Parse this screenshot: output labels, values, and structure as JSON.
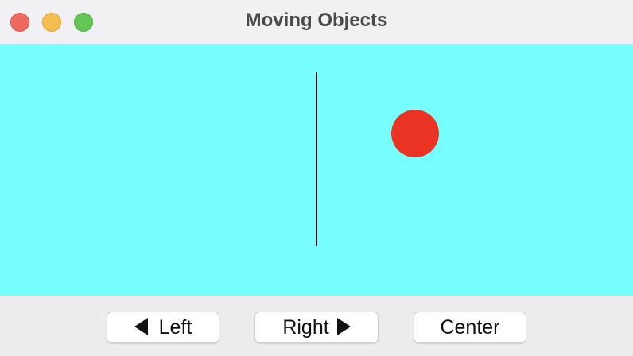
{
  "window": {
    "title": "Moving Objects"
  },
  "canvas": {
    "background_color": "#77ffff",
    "line_color": "#111111",
    "ball_color": "#ea3323"
  },
  "buttons": {
    "left": {
      "label": "Left",
      "icon": "left-triangle-icon"
    },
    "right": {
      "label": "Right",
      "icon": "right-triangle-icon"
    },
    "center": {
      "label": "Center"
    }
  }
}
